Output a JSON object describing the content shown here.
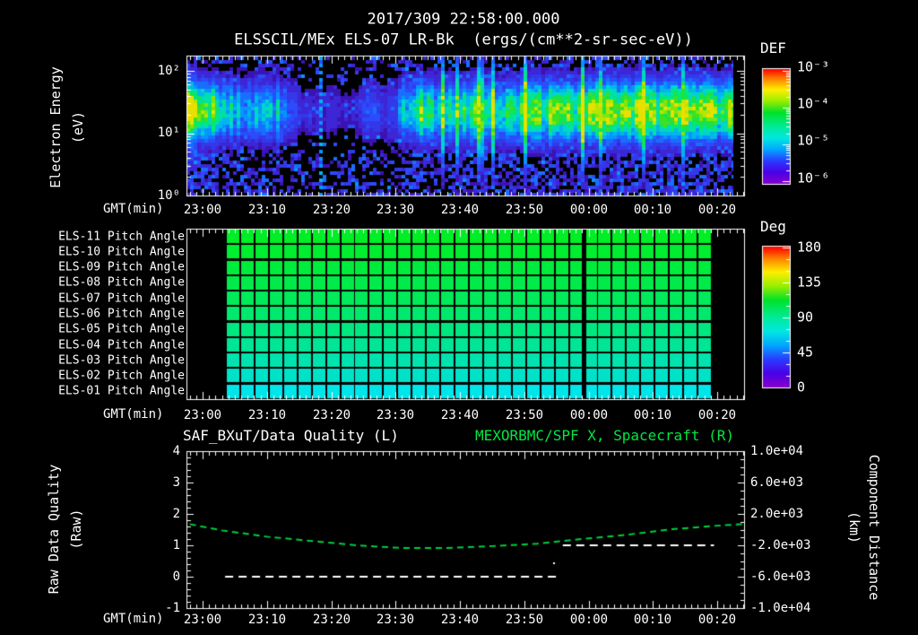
{
  "title": {
    "line1": "2017/309 22:58:00.000",
    "line2": "ELSSCIL/MEx ELS-07 LR-Bk  (ergs/(cm**2-sr-sec-eV))"
  },
  "labels": {
    "gmt": "GMT(min)"
  },
  "x_ticks": [
    "23:00",
    "23:10",
    "23:20",
    "23:30",
    "23:40",
    "23:50",
    "00:00",
    "00:10",
    "00:20"
  ],
  "colors": {
    "background": "#000000",
    "text": "#ffffff",
    "title_green": "#00e841",
    "distance_curve_green": "#00cf3f",
    "quality_line_white": "#ffffff",
    "colorbar_stops": [
      [
        0,
        "#ff0000"
      ],
      [
        0.09,
        "#ff8800"
      ],
      [
        0.18,
        "#ffee00"
      ],
      [
        0.28,
        "#99ee00"
      ],
      [
        0.38,
        "#00e22a"
      ],
      [
        0.5,
        "#00eb96"
      ],
      [
        0.6,
        "#00e8e0"
      ],
      [
        0.7,
        "#00a8ff"
      ],
      [
        0.8,
        "#2a3cff"
      ],
      [
        0.9,
        "#4a00e8"
      ],
      [
        1,
        "#8800cc"
      ]
    ],
    "spectrogram_stops": [
      [
        0,
        "#3c0090"
      ],
      [
        0.14,
        "#3c28d8"
      ],
      [
        0.28,
        "#2850ff"
      ],
      [
        0.42,
        "#00a0ff"
      ],
      [
        0.55,
        "#00dcc8"
      ],
      [
        0.66,
        "#00e878"
      ],
      [
        0.78,
        "#28e028"
      ],
      [
        0.9,
        "#a0e800"
      ],
      [
        1,
        "#e8e000"
      ]
    ]
  },
  "panels": {
    "spectrogram": {
      "y_axis_title_line1": "Electron Energy",
      "y_axis_title_line2": "(eV)",
      "y_ticks": [
        "10²",
        "10¹",
        "10⁰"
      ],
      "colorbar": {
        "title": "DEF",
        "ticks": [
          "10⁻³",
          "10⁻⁴",
          "10⁻⁵",
          "10⁻⁶"
        ]
      }
    },
    "pitch": {
      "row_labels": [
        "ELS-11 Pitch Angle",
        "ELS-10 Pitch Angle",
        "ELS-09 Pitch Angle",
        "ELS-08 Pitch Angle",
        "ELS-07 Pitch Angle",
        "ELS-06 Pitch Angle",
        "ELS-05 Pitch Angle",
        "ELS-04 Pitch Angle",
        "ELS-03 Pitch Angle",
        "ELS-02 Pitch Angle",
        "ELS-01 Pitch Angle"
      ],
      "colorbar": {
        "title": "Deg",
        "ticks": [
          "180",
          "135",
          "90",
          "45",
          "0"
        ]
      }
    },
    "quality": {
      "title_left": "SAF_BXuT/Data Quality (L)",
      "title_right": "MEXORBMC/SPF X, Spacecraft (R)",
      "y_axis_title_line1": "Raw Data Quality",
      "y_axis_title_line2": "(Raw)",
      "y_ticks_left": [
        "4",
        "3",
        "2",
        "1",
        "0",
        "-1"
      ],
      "y_axis_right_title_line1": "Component Distance",
      "y_axis_right_title_line2": "(km)",
      "y_ticks_right": [
        "1.0e+04",
        "6.0e+03",
        "2.0e+03",
        "-2.0e+03",
        "-6.0e+03",
        "-1.0e+04"
      ]
    }
  },
  "chart_data": [
    {
      "type": "heatmap",
      "name": "electron-energy-spectrogram",
      "title": "ELSSCIL/MEx ELS-07 LR-Bk (ergs/(cm**2-sr-sec-eV))",
      "xlabel": "GMT(min)",
      "ylabel": "Electron Energy (eV)",
      "x_start_gmt": "22:58",
      "x_end_gmt": "00:24",
      "x_tick_labels": [
        "23:00",
        "23:10",
        "23:20",
        "23:30",
        "23:40",
        "23:50",
        "00:00",
        "00:10",
        "00:20"
      ],
      "y_scale": "log",
      "ylim_ev": [
        1,
        250
      ],
      "colorbar_label": "DEF",
      "colorbar_log10_range": [
        -6,
        -3
      ],
      "band_center_ev": 22,
      "band_sigma_log10": 0.32,
      "time_envelope_min_intensity": [
        [
          0,
          1.08
        ],
        [
          2,
          1.05
        ],
        [
          3,
          0.95
        ],
        [
          5,
          0.68
        ],
        [
          7,
          0.58
        ],
        [
          10,
          0.55
        ],
        [
          13,
          0.58
        ],
        [
          15,
          0.45
        ],
        [
          16,
          0.3
        ],
        [
          17.5,
          0.15
        ],
        [
          26,
          0.12
        ],
        [
          28,
          0.3
        ],
        [
          30,
          0.25
        ],
        [
          32,
          0.22
        ],
        [
          34,
          0.7
        ],
        [
          36,
          0.85
        ],
        [
          38,
          0.66
        ],
        [
          40,
          0.7
        ],
        [
          44,
          0.78
        ],
        [
          48,
          0.8
        ],
        [
          52,
          0.8
        ],
        [
          56,
          0.83
        ],
        [
          60,
          0.86
        ],
        [
          64,
          0.92
        ],
        [
          67,
          0.98
        ],
        [
          70,
          1.06
        ],
        [
          72,
          1.0
        ],
        [
          74,
          1.04
        ],
        [
          76,
          0.92
        ],
        [
          78,
          0.96
        ],
        [
          80,
          0.9
        ],
        [
          82,
          0.92
        ],
        [
          84,
          0.97
        ],
        [
          86,
          0.93
        ]
      ],
      "dotted_cyan_line_minute": 20.5
    },
    {
      "type": "heatmap",
      "name": "pitch-angle-rows",
      "rows": [
        "ELS-11",
        "ELS-10",
        "ELS-09",
        "ELS-08",
        "ELS-07",
        "ELS-06",
        "ELS-05",
        "ELS-04",
        "ELS-03",
        "ELS-02",
        "ELS-01"
      ],
      "row_pitch_deg_approx": [
        105,
        103,
        101,
        99,
        96,
        93,
        90,
        86,
        82,
        78,
        74
      ],
      "row_colors": [
        "#00ee26",
        "#00ed30",
        "#00ec3c",
        "#00eb4a",
        "#00ea5a",
        "#00e96c",
        "#00e780",
        "#00e596",
        "#00e3ae",
        "#00e2c8",
        "#00e5ea"
      ],
      "colorbar_label": "Deg",
      "colorbar_range": [
        0,
        180
      ],
      "columns": 34,
      "data_start_min": 5.6,
      "data_end_min": 81.2,
      "gap_minute": 61.2
    },
    {
      "type": "line",
      "name": "quality-and-distance",
      "xlabel": "GMT(min)",
      "ylim_left": [
        -1,
        4
      ],
      "ylim_right": [
        -10000,
        10000
      ],
      "series": [
        {
          "name": "SAF_BXuT/Data Quality (L)",
          "axis": "left",
          "style": "dashed",
          "color": "#ffffff",
          "segments": [
            {
              "value": 0,
              "from_min": 5.5,
              "to_min": 57.0
            },
            {
              "value": 1,
              "from_min": 58.0,
              "to_min": 81.5
            }
          ],
          "stray_point": {
            "minute": 56.5,
            "value": 0.45
          }
        },
        {
          "name": "MEXORBMC/SPF X, Spacecraft (R)",
          "axis": "right",
          "style": "dashed",
          "color": "#00cf3f",
          "x_minutes": [
            0,
            5,
            12,
            19,
            26,
            33,
            40,
            47,
            54,
            61,
            68,
            75,
            82,
            86
          ],
          "values_km": [
            700,
            -100,
            -900,
            -1450,
            -2000,
            -2350,
            -2350,
            -2100,
            -1800,
            -1200,
            -650,
            50,
            500,
            700
          ]
        }
      ]
    }
  ]
}
